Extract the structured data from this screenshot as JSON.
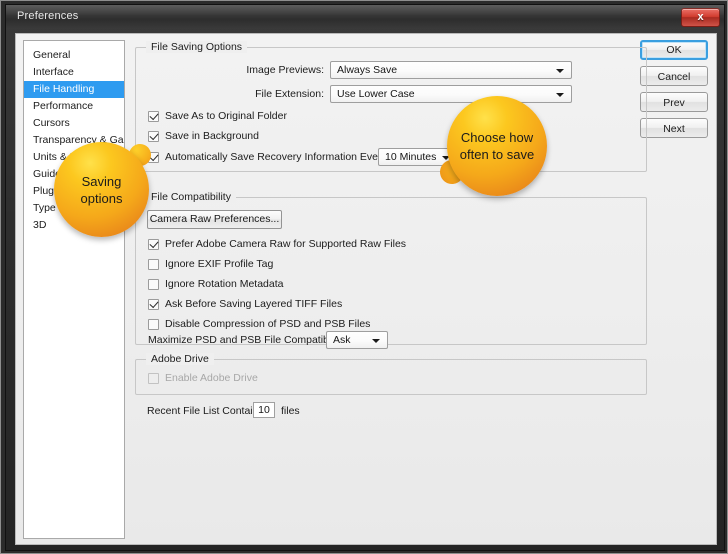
{
  "window": {
    "title": "Preferences",
    "close_label": "✕"
  },
  "sidebar": {
    "items": [
      {
        "label": "General",
        "selected": false
      },
      {
        "label": "Interface",
        "selected": false
      },
      {
        "label": "File Handling",
        "selected": true
      },
      {
        "label": "Performance",
        "selected": false
      },
      {
        "label": "Cursors",
        "selected": false
      },
      {
        "label": "Transparency & Gamut",
        "selected": false
      },
      {
        "label": "Units & Rulers",
        "selected": false
      },
      {
        "label": "Guides, Grid & Slices",
        "selected": false
      },
      {
        "label": "Plug-Ins",
        "selected": false
      },
      {
        "label": "Type",
        "selected": false
      },
      {
        "label": "3D",
        "selected": false
      }
    ]
  },
  "buttons": {
    "ok": "OK",
    "cancel": "Cancel",
    "prev": "Prev",
    "next": "Next"
  },
  "file_saving_options": {
    "title": "File Saving Options",
    "image_previews_label": "Image Previews:",
    "image_previews_value": "Always Save",
    "file_extension_label": "File Extension:",
    "file_extension_value": "Use Lower Case",
    "save_as_original_folder": "Save As to Original Folder",
    "save_in_background": "Save in Background",
    "auto_save_recovery": "Automatically Save Recovery Information Every:",
    "auto_save_interval": "10 Minutes"
  },
  "file_compatibility": {
    "title": "File Compatibility",
    "camera_raw_button": "Camera Raw Preferences...",
    "prefer_camera_raw": "Prefer Adobe Camera Raw for Supported Raw Files",
    "ignore_exif": "Ignore EXIF Profile Tag",
    "ignore_rotation": "Ignore Rotation Metadata",
    "ask_before_tiff": "Ask Before Saving Layered TIFF Files",
    "disable_compression": "Disable Compression of PSD and PSB Files",
    "maximize_label": "Maximize PSD and PSB File Compatibilty:",
    "maximize_value": "Ask"
  },
  "adobe_drive": {
    "title": "Adobe Drive",
    "enable_label": "Enable Adobe Drive"
  },
  "recent_files": {
    "label": "Recent File List Contains:",
    "value": "10",
    "suffix": "files"
  },
  "callouts": {
    "saving": "Saving options",
    "choose_line1": "Choose how",
    "choose_line2": "often to save"
  },
  "colors": {
    "accent_selected": "#2e9bf0",
    "callout_top": "#fcc81f",
    "callout_bottom": "#e8851a",
    "close_button": "#d23d30"
  }
}
